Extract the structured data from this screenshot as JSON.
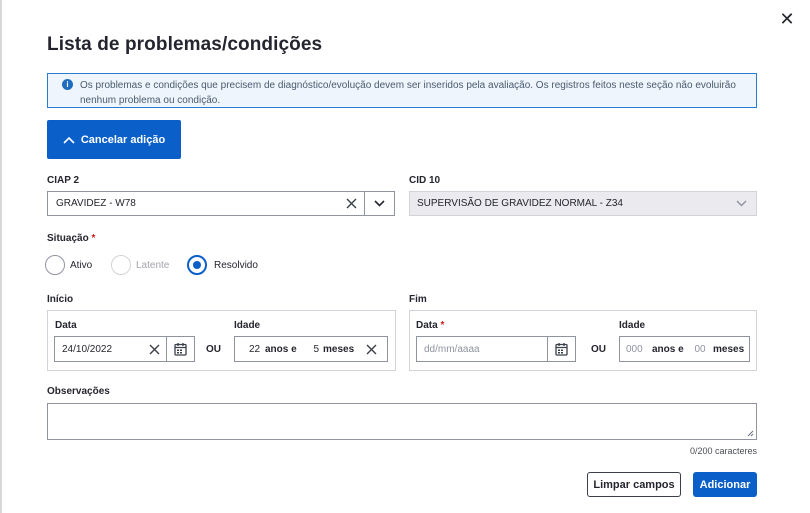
{
  "dialog": {
    "title": "Lista de problemas/condições",
    "close_symbol": "✕",
    "alert_text": "Os problemas e condições que precisem de diagnóstico/evolução devem ser inseridos pela avaliação. Os registros feitos neste seção não evoluirão nenhum problema ou condição.",
    "cancel_button": "Cancelar adição"
  },
  "ciap": {
    "label": "CIAP 2",
    "value": "GRAVIDEZ - W78"
  },
  "cid": {
    "label": "CID 10",
    "value": "SUPERVISÃO DE GRAVIDEZ NORMAL - Z34"
  },
  "situacao": {
    "label": "Situação",
    "required_mark": "*",
    "options": [
      {
        "label": "Ativo",
        "state": "unchecked"
      },
      {
        "label": "Latente",
        "state": "disabled"
      },
      {
        "label": "Resolvido",
        "state": "checked"
      }
    ]
  },
  "inicio": {
    "label": "Início",
    "data_label": "Data",
    "data_value": "24/10/2022",
    "ou": "OU",
    "idade_label": "Idade",
    "anos_value": "22",
    "anos_unit": "anos e",
    "meses_value": "5",
    "meses_unit": "meses"
  },
  "fim": {
    "label": "Fim",
    "data_label": "Data",
    "required_mark": "*",
    "data_placeholder": "dd/mm/aaaa",
    "ou": "OU",
    "idade_label": "Idade",
    "anos_placeholder": "000",
    "anos_unit": "anos e",
    "meses_placeholder": "00",
    "meses_unit": "meses"
  },
  "observacoes": {
    "label": "Observações",
    "counter": "0/200 caracteres"
  },
  "footer": {
    "clear_button": "Limpar campos",
    "add_button": "Adicionar"
  },
  "icons": {
    "close": "close-icon",
    "info": "info-icon",
    "chevron_up": "chevron-up-icon",
    "chevron_down": "chevron-down-icon",
    "clear": "clear-icon",
    "calendar": "calendar-icon"
  },
  "colors": {
    "primary": "#0a5fc9",
    "required": "#d01d1d",
    "alert_border": "#2a7cd1",
    "alert_bg": "#eef5fc"
  }
}
